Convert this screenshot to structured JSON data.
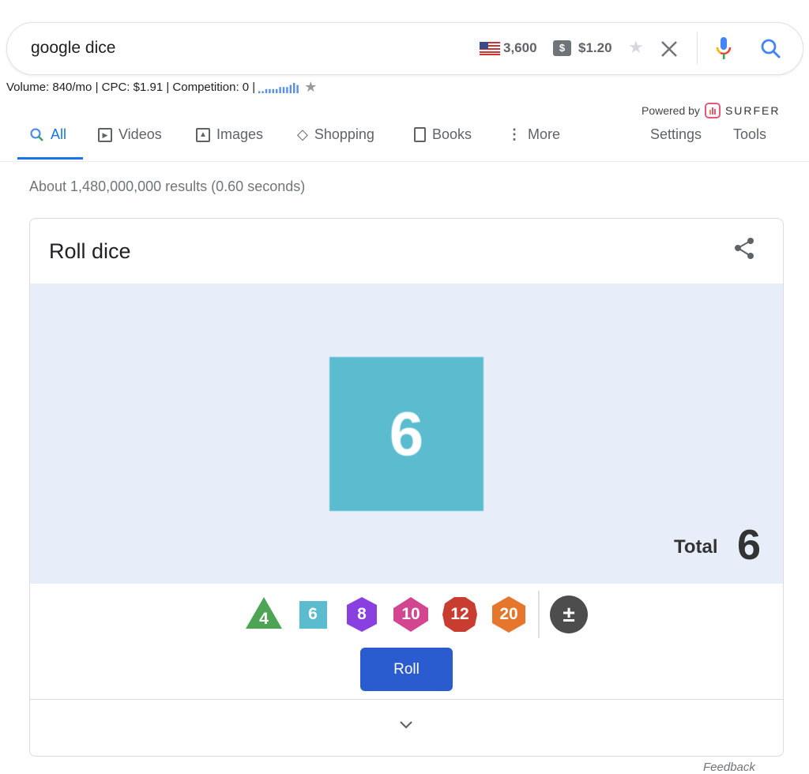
{
  "search": {
    "query": "google dice",
    "volume": "3,600",
    "cpc": "$1.20"
  },
  "keyword_bar": {
    "text": "Volume: 840/mo | CPC: $1.91 | Competition: 0 |",
    "trend": [
      1,
      1,
      2,
      2,
      2,
      2,
      3,
      3,
      3,
      4,
      5,
      4
    ]
  },
  "powered": {
    "label": "Powered by",
    "brand": "SURFER",
    "brand_color": "#e8577a"
  },
  "tabs": [
    {
      "label": "All",
      "active": true
    },
    {
      "label": "Videos"
    },
    {
      "label": "Images"
    },
    {
      "label": "Shopping"
    },
    {
      "label": "Books"
    },
    {
      "label": "More"
    }
  ],
  "tools": {
    "settings": "Settings",
    "tools": "Tools"
  },
  "stats": "About 1,480,000,000 results (0.60 seconds)",
  "card": {
    "title": "Roll dice",
    "die_value": "6",
    "total_label": "Total",
    "total_value": "6",
    "roll_label": "Roll",
    "dice": [
      {
        "label": "4",
        "color": "#4ea455"
      },
      {
        "label": "6",
        "color": "#5bbcd0"
      },
      {
        "label": "8",
        "color": "#8a3fe0"
      },
      {
        "label": "10",
        "color": "#d1468f"
      },
      {
        "label": "12",
        "color": "#c93d31"
      },
      {
        "label": "20",
        "color": "#e5762b"
      }
    ],
    "modifier_label": "±"
  },
  "feedback": "Feedback"
}
